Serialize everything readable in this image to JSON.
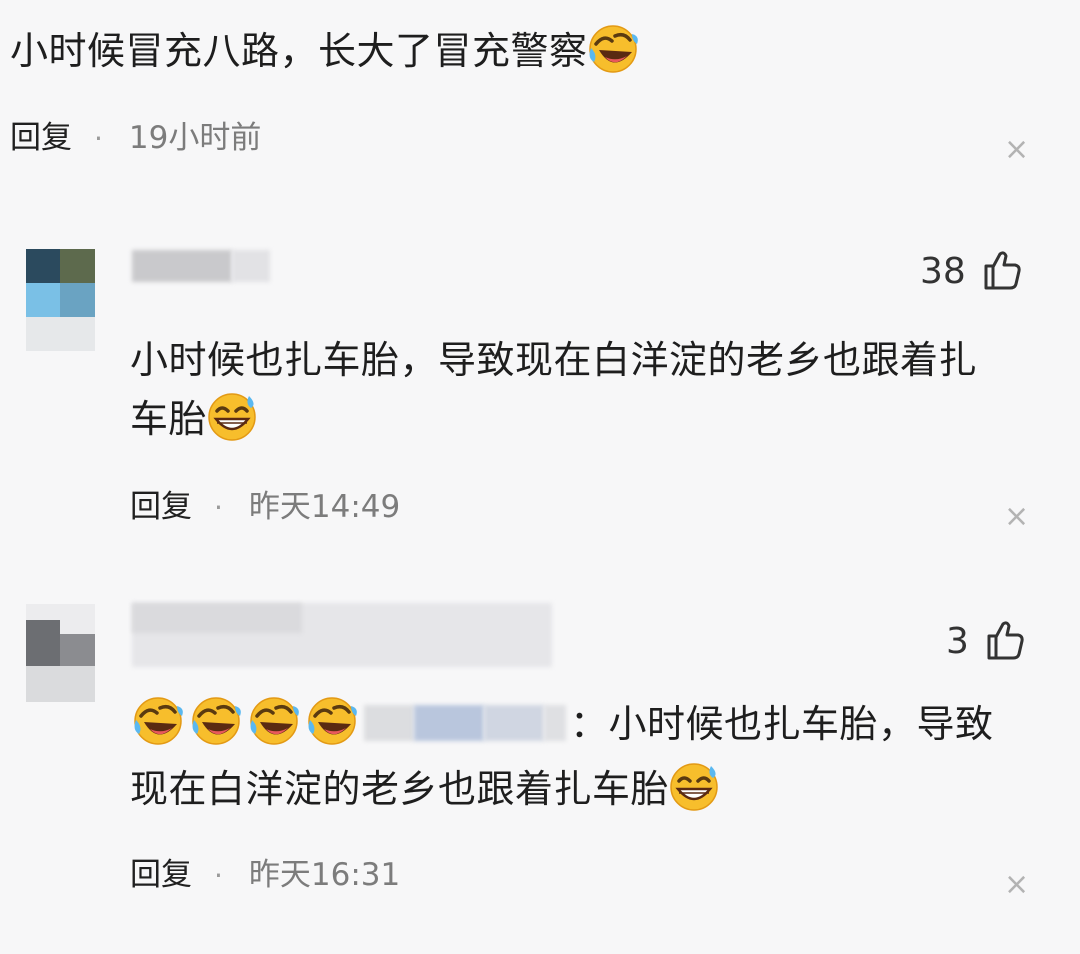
{
  "comments": [
    {
      "text_before_emoji": "小时候冒充八路，长大了冒充警察",
      "emoji_after": "rofl-emoji",
      "reply_label": "回复",
      "separator": "·",
      "time": "19小时前",
      "close_icon": "×"
    },
    {
      "likes": "38",
      "line1": "小时候也扎车胎，导致现在白洋淀的老乡也跟着扎",
      "line2": "车胎",
      "emoji_after": "grin-sweat-emoji",
      "reply_label": "回复",
      "separator": "·",
      "time": "昨天14:49",
      "close_icon": "×"
    },
    {
      "likes": "3",
      "emojis_before": [
        "rofl-emoji",
        "rofl-emoji",
        "rofl-emoji",
        "rofl-emoji"
      ],
      "line1_after_name": "：小时候也扎车胎，导致",
      "line2": "现在白洋淀的老乡也跟着扎车胎",
      "emoji_after": "grin-sweat-emoji",
      "reply_label": "回复",
      "separator": "·",
      "time": "昨天16:31",
      "close_icon": "×"
    }
  ],
  "colors": {
    "background": "#f7f7f8",
    "emoji_yellow": "#f5b82a",
    "muted_text": "#7c7c7c"
  }
}
